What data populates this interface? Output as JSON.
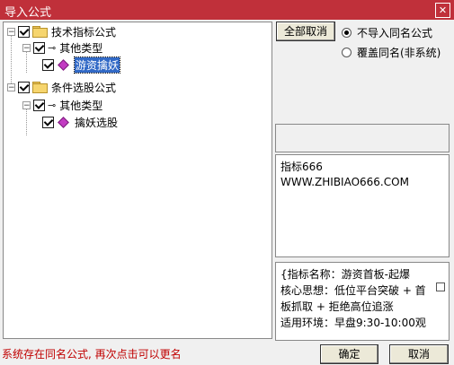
{
  "window": {
    "title": "导入公式",
    "close_glyph": "✕"
  },
  "tree": {
    "nodes": [
      {
        "label": "技术指标公式",
        "expander": "−"
      },
      {
        "label": "其他类型",
        "expander": "−"
      },
      {
        "label": "游资擒妖",
        "selected": true
      },
      {
        "label": "条件选股公式",
        "expander": "−"
      },
      {
        "label": "其他类型",
        "expander": "−"
      },
      {
        "label": "擒妖选股"
      }
    ],
    "icons": {
      "key": "⊸",
      "gem": "diamond-icon"
    }
  },
  "options": {
    "deselect_all": "全部取消",
    "no_import_same": "不导入同名公式",
    "overwrite_same": "覆盖同名(非系统)",
    "selected": "no_import_same"
  },
  "info": {
    "line1": "指标666",
    "line2": "WWW.ZHIBIAO666.COM"
  },
  "description": {
    "line1": "{指标名称：游资首板-起爆",
    "line2": "核心思想：低位平台突破 + 首",
    "line3": "板抓取 + 拒绝高位追涨",
    "line4": "适用环境：早盘9:30-10:00观"
  },
  "footer": {
    "status": "系统存在同名公式, 再次点击可以更名",
    "ok": "确定",
    "cancel": "取消",
    "status_color": "#C00000"
  },
  "colors": {
    "titlebar": "#C0303A",
    "selection": "#3169C6"
  }
}
